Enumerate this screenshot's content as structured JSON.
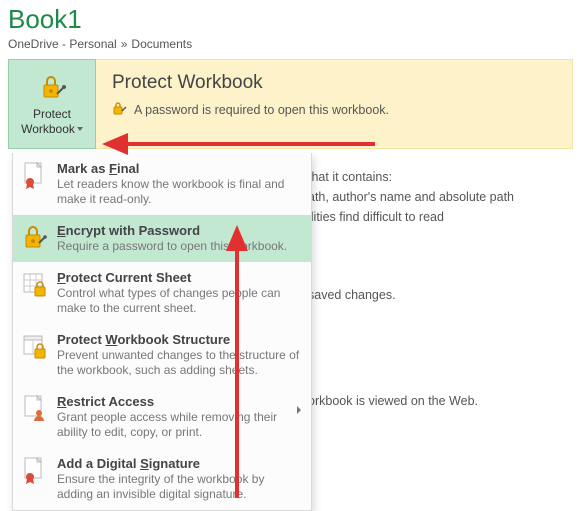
{
  "title": "Book1",
  "breadcrumb": {
    "part1": "OneDrive - Personal",
    "sep": "»",
    "part2": "Documents"
  },
  "button": {
    "line1": "Protect",
    "line2": "Workbook"
  },
  "banner": {
    "heading": "Protect Workbook",
    "text": "A password is required to open this workbook."
  },
  "menu": [
    {
      "title_pre": "Mark as ",
      "title_ul": "F",
      "title_post": "inal",
      "desc": "Let readers know the workbook is final and make it read-only."
    },
    {
      "title_pre": "",
      "title_ul": "E",
      "title_post": "ncrypt with Password",
      "desc": "Require a password to open this workbook."
    },
    {
      "title_pre": "",
      "title_ul": "P",
      "title_post": "rotect Current Sheet",
      "desc": "Control what types of changes people can make to the current sheet."
    },
    {
      "title_pre": "Protect ",
      "title_ul": "W",
      "title_post": "orkbook Structure",
      "desc": "Prevent unwanted changes to the structure of the workbook, such as adding sheets."
    },
    {
      "title_pre": "",
      "title_ul": "R",
      "title_post": "estrict Access",
      "desc": "Grant people access while removing their ability to edit, copy, or print."
    },
    {
      "title_pre": "Add a Digital ",
      "title_ul": "S",
      "title_post": "ignature",
      "desc": "Ensure the integrity of the workbook by adding an invisible digital signature."
    }
  ],
  "background": {
    "b1": "that it contains:",
    "b2": "ath, author's name and absolute path",
    "b3": "ilities find difficult to read",
    "b4": "saved changes.",
    "b5": "orkbook is viewed on the Web."
  }
}
